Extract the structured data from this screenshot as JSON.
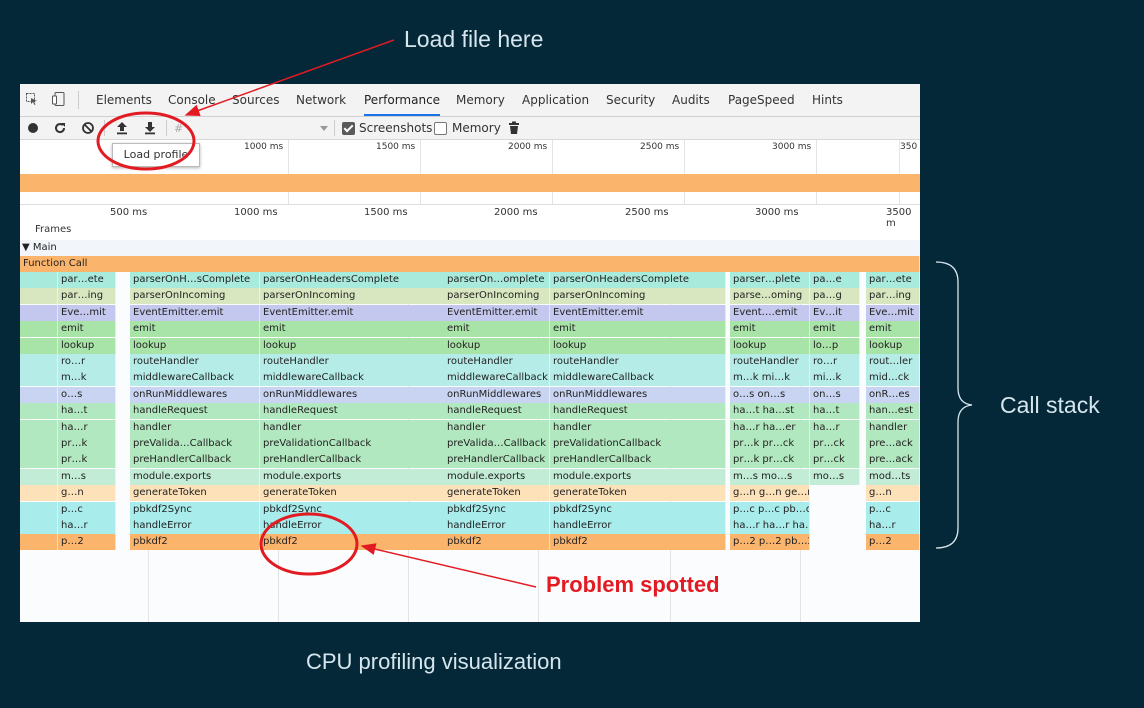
{
  "annotations": {
    "load_file": "Load file here",
    "call_stack": "Call stack",
    "problem": "Problem spotted",
    "caption": "CPU profiling visualization"
  },
  "colors": {
    "background": "#042838",
    "annotation_red": "#e21b23",
    "function_call": "#fbb46b",
    "active_tab": "#1a73e8"
  },
  "devtools": {
    "tabs": [
      "Elements",
      "Console",
      "Sources",
      "Network",
      "Performance",
      "Memory",
      "Application",
      "Security",
      "Audits",
      "PageSpeed",
      "Hints"
    ],
    "active_tab": "Performance",
    "toolbar": {
      "icons": [
        "record-icon",
        "reload-icon",
        "clear-icon",
        "upload-icon",
        "download-icon",
        "hash-icon",
        "dropdown-icon",
        "trash-icon"
      ],
      "screenshots_label": "Screenshots",
      "screenshots_checked": true,
      "memory_label": "Memory",
      "memory_checked": false,
      "tooltip": "Load profile"
    },
    "overview_ticks": [
      "1000 ms",
      "1500 ms",
      "2000 ms",
      "2500 ms",
      "3000 ms",
      "350"
    ],
    "timeline_ticks": [
      "500 ms",
      "1000 ms",
      "1500 ms",
      "2000 ms",
      "2500 ms",
      "3000 ms",
      "3500 m"
    ],
    "frames_label": "Frames",
    "main_label": "▼ Main",
    "function_call_label": "Function Call",
    "flame_rows": [
      [
        "par…ete",
        "parserOnH…sComplete",
        "parserOnHeadersComplete",
        "parserOn…omplete",
        "parserOnHeadersComplete",
        "parser…plete",
        "pa…e",
        "par…ete"
      ],
      [
        "par…ing",
        "parserOnIncoming",
        "parserOnIncoming",
        "parserOnIncoming",
        "parserOnIncoming",
        "parse…oming",
        "pa…g",
        "par…ing"
      ],
      [
        "Eve…mit",
        "EventEmitter.emit",
        "EventEmitter.emit",
        "EventEmitter.emit",
        "EventEmitter.emit",
        "Event….emit",
        "Ev…it",
        "Eve…mit"
      ],
      [
        "emit",
        "emit",
        "emit",
        "emit",
        "emit",
        "emit",
        "emit",
        "emit"
      ],
      [
        "lookup",
        "lookup",
        "lookup",
        "lookup",
        "lookup",
        "lookup",
        "lo…p",
        "lookup"
      ],
      [
        "ro…r",
        "routeHandler",
        "routeHandler",
        "routeHandler",
        "routeHandler",
        "routeHandler",
        "ro…r",
        "rout…ler"
      ],
      [
        "m…k",
        "middlewareCallback",
        "middlewareCallback",
        "middlewareCallback",
        "middlewareCallback",
        "m…k  mi…k",
        "mi…k",
        "mid…ck"
      ],
      [
        "o…s",
        "onRunMiddlewares",
        "onRunMiddlewares",
        "onRunMiddlewares",
        "onRunMiddlewares",
        "o…s  on…s",
        "on…s",
        "onR…es"
      ],
      [
        "ha…t",
        "handleRequest",
        "handleRequest",
        "handleRequest",
        "handleRequest",
        "ha…t  ha…st",
        "ha…t",
        "han…est"
      ],
      [
        "ha…r",
        "handler",
        "handler",
        "handler",
        "handler",
        "ha…r  ha…er",
        "ha…r",
        "handler"
      ],
      [
        "pr…k",
        "preValida…Callback",
        "preValidationCallback",
        "preValida…Callback",
        "preValidationCallback",
        "pr…k  pr…ck",
        "pr…ck",
        "pre…ack"
      ],
      [
        "pr…k",
        "preHandlerCallback",
        "preHandlerCallback",
        "preHandlerCallback",
        "preHandlerCallback",
        "pr…k  pr…ck",
        "pr…ck",
        "pre…ack"
      ],
      [
        "m…s",
        "module.exports",
        "module.exports",
        "module.exports",
        "module.exports",
        "m…s  mo…s",
        "mo…s",
        "mod…ts"
      ],
      [
        "g…n",
        "generateToken",
        "generateToken",
        "generateToken",
        "generateToken",
        "g…n  g…n  ge…n",
        "",
        "g…n"
      ],
      [
        "p…c",
        "pbkdf2Sync",
        "pbkdf2Sync",
        "pbkdf2Sync",
        "pbkdf2Sync",
        "p…c  p…c  pb…c",
        "",
        "p…c"
      ],
      [
        "ha…r",
        "handleError",
        "handleError",
        "handleError",
        "handleError",
        "ha…r  ha…r  ha…or",
        "",
        "ha…r"
      ],
      [
        "p…2",
        "pbkdf2",
        "pbkdf2",
        "pbkdf2",
        "pbkdf2",
        "p…2  p…2  pb…2",
        "",
        "p…2"
      ]
    ]
  }
}
